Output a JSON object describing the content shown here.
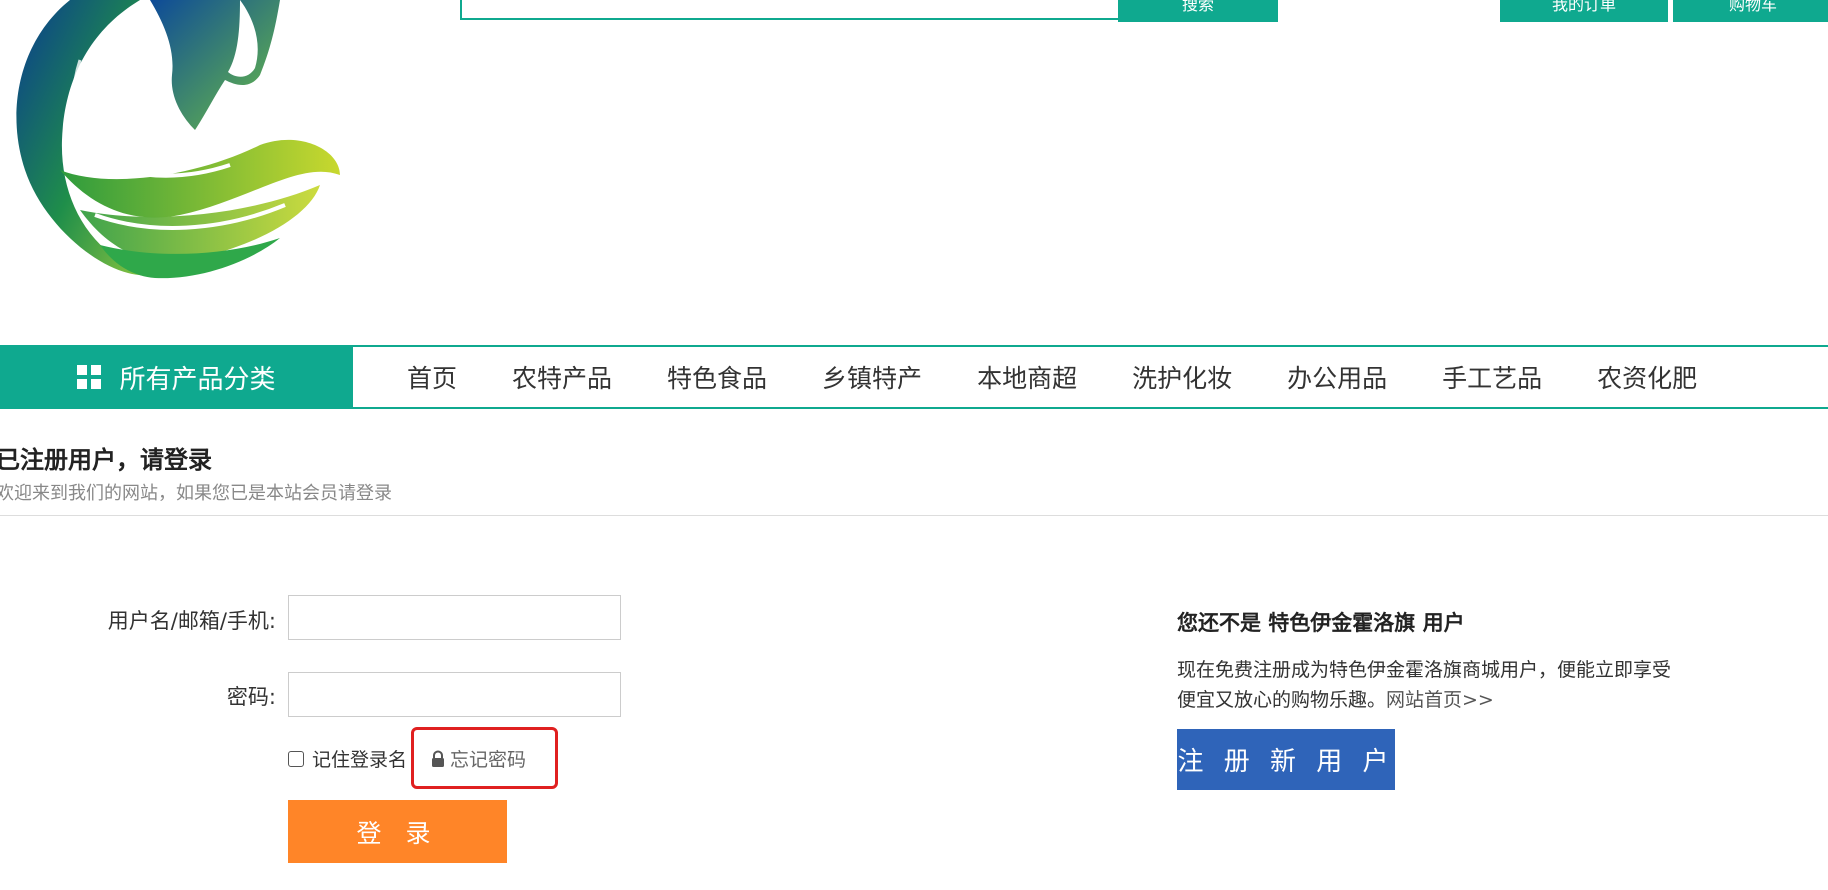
{
  "header": {
    "search_button": "搜索",
    "top_buttons": [
      "我的订单",
      "购物车"
    ]
  },
  "nav": {
    "category_label": "所有产品分类",
    "items": [
      "首页",
      "农特产品",
      "特色食品",
      "乡镇特产",
      "本地商超",
      "洗护化妆",
      "办公用品",
      "手工艺品",
      "农资化肥"
    ]
  },
  "section": {
    "title": "已注册用户，请登录",
    "subtitle": "欢迎来到我们的网站，如果您已是本站会员请登录"
  },
  "login": {
    "username_label": "用户名/邮箱/手机:",
    "password_label": "密码:",
    "remember_label": "记住登录名",
    "forgot_label": "忘记密码",
    "login_button": "登 录"
  },
  "register": {
    "title": "您还不是 特色伊金霍洛旗 用户",
    "desc": "现在免费注册成为特色伊金霍洛旗商城用户，便能立即享受便宜又放心的购物乐趣。",
    "home_link": "网站首页>>",
    "button": "注 册 新 用 户"
  },
  "colors": {
    "primary_teal": "#0fa98f",
    "login_orange": "#ff8528",
    "register_blue": "#2f64b9",
    "highlight_red": "#e02020"
  }
}
